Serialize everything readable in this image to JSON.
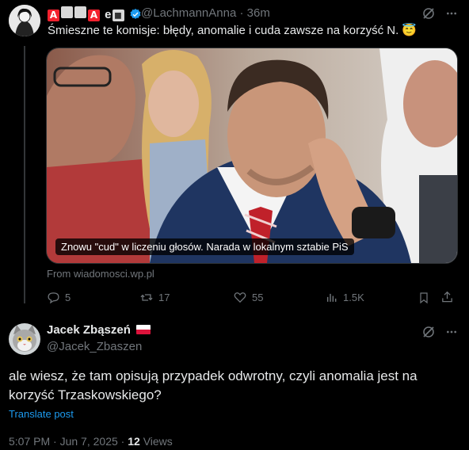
{
  "tweet1": {
    "display_name_suffix": "e",
    "handle": "@LachmannAnna",
    "time": "36m",
    "text": "Śmieszne te komisje: błędy, anomalie i cuda zawsze na korzyść N. 😇",
    "image_caption": "Znowu \"cud\" w liczeniu głosów. Narada w lokalnym sztabie PiS",
    "source": "From wiadomosci.wp.pl",
    "replies": "5",
    "reposts": "17",
    "likes": "55",
    "views": "1.5K"
  },
  "tweet2": {
    "display_name": "Jacek Zbąszeń",
    "handle": "@Jacek_Zbaszen",
    "text": "ale wiesz, że tam opisują przypadek odwrotny, czyli anomalia jest na korzyść Trzaskowskiego?",
    "translate": "Translate post",
    "time": "5:07 PM",
    "date": "Jun 7, 2025",
    "views_count": "12",
    "views_label": "Views"
  },
  "colors": {
    "accent": "#1d9bf0",
    "muted": "#71767b",
    "badge_red": "#f4212e"
  }
}
